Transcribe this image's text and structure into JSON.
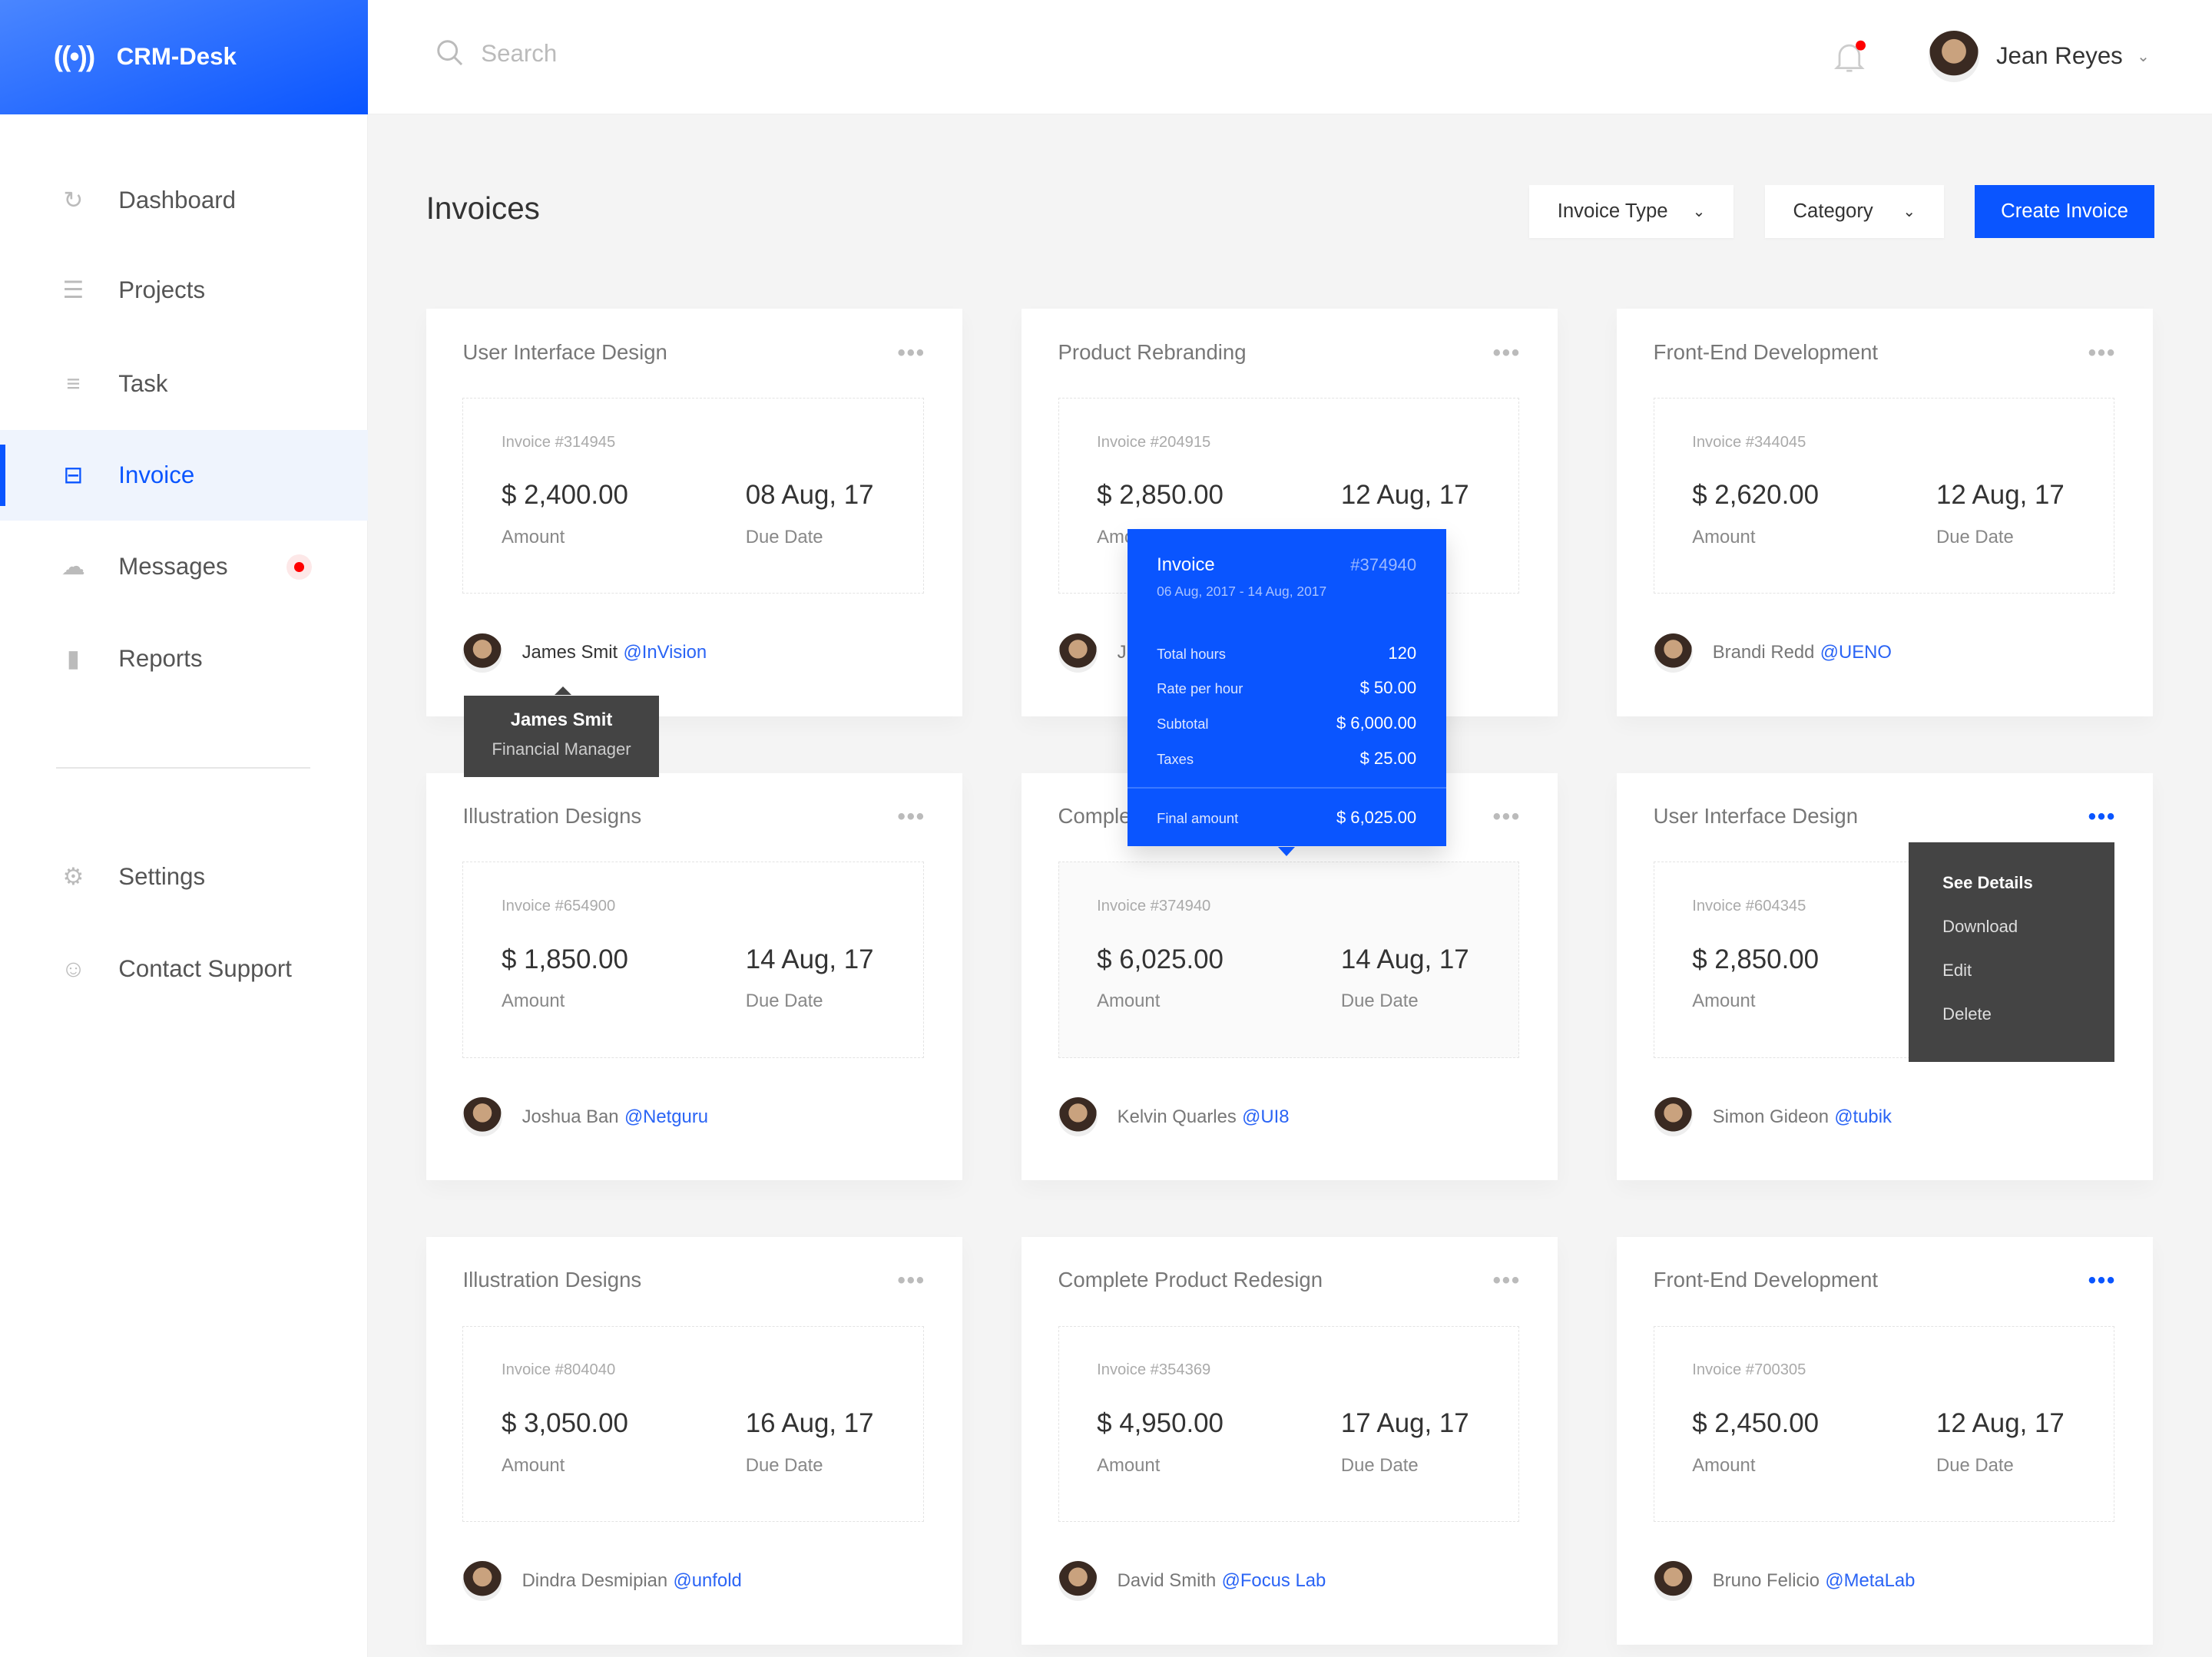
{
  "brand": {
    "logo_icon": "broadcast-icon",
    "name": "CRM-Desk",
    "color": "#0a55ff"
  },
  "header": {
    "search_placeholder": "Search",
    "user_name": "Jean Reyes"
  },
  "sidebar": {
    "items": [
      {
        "label": "Dashboard",
        "icon": "dashboard-icon"
      },
      {
        "label": "Projects",
        "icon": "projects-icon"
      },
      {
        "label": "Task",
        "icon": "task-icon"
      },
      {
        "label": "Invoice",
        "icon": "invoice-icon",
        "active": true
      },
      {
        "label": "Messages",
        "icon": "messages-icon",
        "badge": true
      },
      {
        "label": "Reports",
        "icon": "reports-icon"
      },
      {
        "label": "Settings",
        "icon": "settings-icon"
      },
      {
        "label": "Contact Support",
        "icon": "support-icon"
      }
    ]
  },
  "page": {
    "title": "Invoices",
    "filter_type": "Invoice Type",
    "filter_category": "Category",
    "create_label": "Create Invoice"
  },
  "cards": [
    {
      "title": "User Interface Design",
      "invoice": "Invoice #314945",
      "amount": "$ 2,400.00",
      "due": "08 Aug, 17",
      "amount_label": "Amount",
      "due_label": "Due Date",
      "person": "James Smit",
      "handle": "@InVision"
    },
    {
      "title": "Product Rebranding",
      "invoice": "Invoice #204915",
      "amount": "$ 2,850.00",
      "due": "12 Aug, 17",
      "amount_label": "Amount",
      "due_label": "Due Date",
      "person": "J",
      "handle": ""
    },
    {
      "title": "Front-End Development",
      "invoice": "Invoice #344045",
      "amount": "$ 2,620.00",
      "due": "12 Aug, 17",
      "amount_label": "Amount",
      "due_label": "Due Date",
      "person": "Brandi Redd",
      "handle": "@UENO"
    },
    {
      "title": "Illustration Designs",
      "invoice": "Invoice #654900",
      "amount": "$ 1,850.00",
      "due": "14 Aug, 17",
      "amount_label": "Amount",
      "due_label": "Due Date",
      "person": "Joshua Ban",
      "handle": "@Netguru"
    },
    {
      "title": "Complete Product Redesign",
      "invoice": "Invoice #374940",
      "amount": "$ 6,025.00",
      "due": "14 Aug, 17",
      "amount_label": "Amount",
      "due_label": "Due Date",
      "person": "Kelvin Quarles",
      "handle": "@UI8",
      "highlighted": true
    },
    {
      "title": "User Interface Design",
      "invoice": "Invoice #604345",
      "amount": "$ 2,850.00",
      "due": "",
      "amount_label": "Amount",
      "due_label": "",
      "person": "Simon Gideon",
      "handle": "@tubik",
      "menu_open": true
    },
    {
      "title": "Illustration Designs",
      "invoice": "Invoice #804040",
      "amount": "$ 3,050.00",
      "due": "16 Aug, 17",
      "amount_label": "Amount",
      "due_label": "Due Date",
      "person": "Dindra Desmipian",
      "handle": "@unfold"
    },
    {
      "title": "Complete Product Redesign",
      "invoice": "Invoice #354369",
      "amount": "$ 4,950.00",
      "due": "17 Aug, 17",
      "amount_label": "Amount",
      "due_label": "Due Date",
      "person": "David Smith",
      "handle": "@Focus Lab"
    },
    {
      "title": "Front-End Development",
      "invoice": "Invoice #700305",
      "amount": "$ 2,450.00",
      "due": "12 Aug, 17",
      "amount_label": "Amount",
      "due_label": "Due Date",
      "person": "Bruno Felicio",
      "handle": "@MetaLab",
      "menu_active": true
    }
  ],
  "person_tooltip": {
    "name": "James Smit",
    "role": "Financial Manager"
  },
  "invoice_popover": {
    "title": "Invoice",
    "number": "#374940",
    "period": "06 Aug, 2017 - 14 Aug, 2017",
    "rows": [
      {
        "label": "Total hours",
        "value": "120"
      },
      {
        "label": "Rate per hour",
        "value": "$ 50.00"
      },
      {
        "label": "Subtotal",
        "value": "$ 6,000.00"
      },
      {
        "label": "Taxes",
        "value": "$ 25.00"
      }
    ],
    "final_label": "Final amount",
    "final_value": "$ 6,025.00"
  },
  "context_menu": {
    "items": [
      "See Details",
      "Download",
      "Edit",
      "Delete"
    ]
  }
}
